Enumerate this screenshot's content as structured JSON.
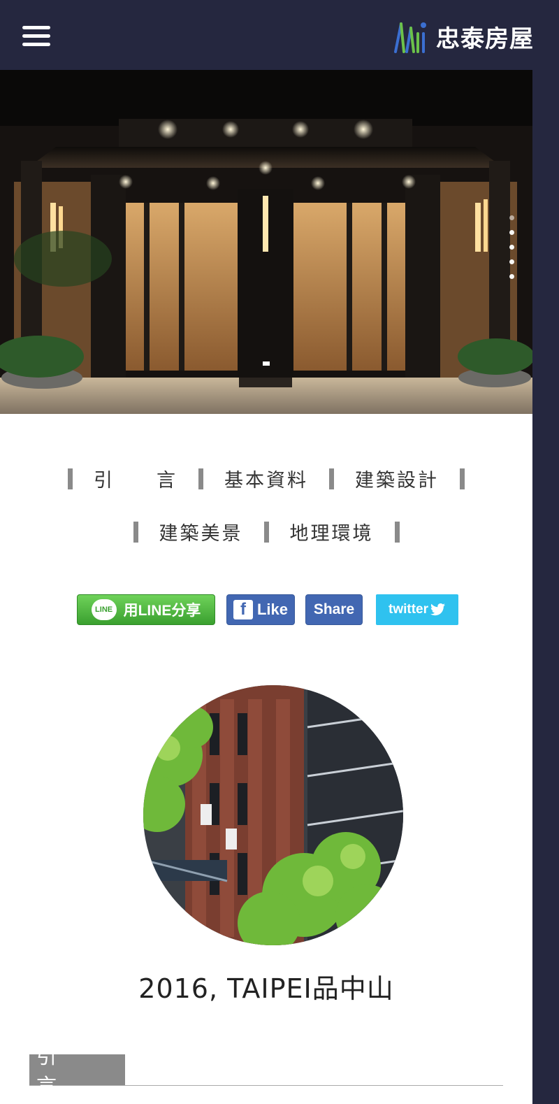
{
  "header": {
    "logo_text": "忠泰房屋",
    "menu_icon": "hamburger-menu-icon",
    "background": "#25273f"
  },
  "hero": {
    "slide_count": 5,
    "active_slide": 1
  },
  "tabs": {
    "row1": [
      "引　　言",
      "基本資料",
      "建築設計"
    ],
    "row2": [
      "建築美景",
      "地理環境"
    ]
  },
  "share": {
    "line_label": "用LINE分享",
    "line_badge": "LINE",
    "fb_like_label": "Like",
    "fb_share_label": "Share",
    "twitter_label": "twitter",
    "colors": {
      "line": "#3aa02f",
      "facebook": "#4267b2",
      "twitter": "#2fc2ef"
    }
  },
  "project": {
    "title": "2016, TAIPEI品中山"
  },
  "section": {
    "label": "引言"
  }
}
